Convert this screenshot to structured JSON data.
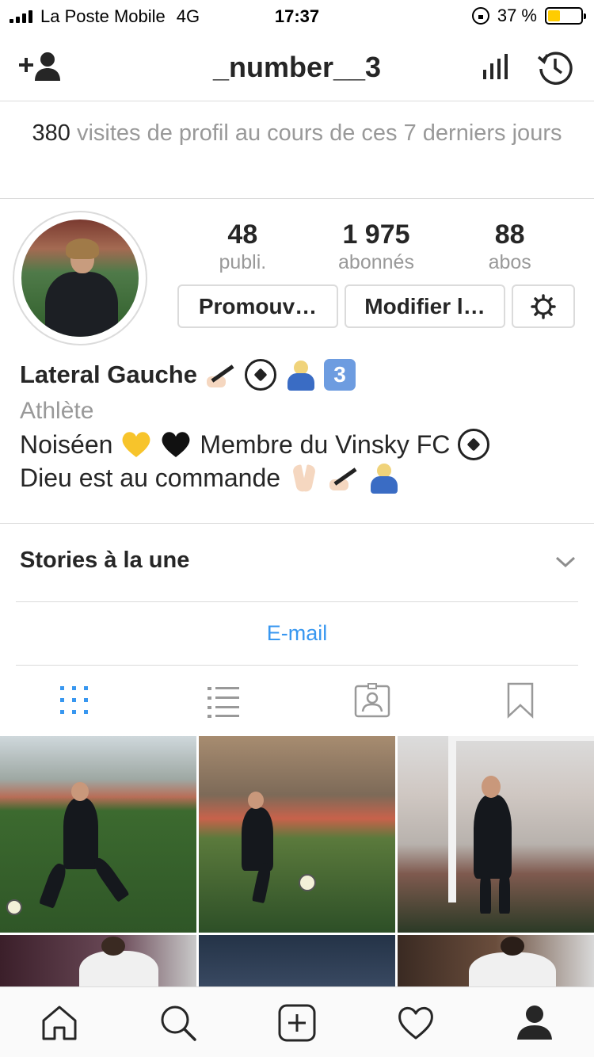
{
  "status_bar": {
    "carrier": "La Poste Mobile",
    "network": "4G",
    "time": "17:37",
    "battery": "37 %",
    "battery_level": 0.37,
    "battery_color": "#ffcc00"
  },
  "header": {
    "username": "_number__3",
    "icons": [
      "add-user-icon",
      "stats-icon",
      "history-icon"
    ]
  },
  "insights": {
    "count": "380",
    "text": " visites de profil au cours de ces 7 derniers jours"
  },
  "profile": {
    "stats": [
      {
        "value": "48",
        "label": "publi."
      },
      {
        "value": "1 975",
        "label": "abonnés"
      },
      {
        "value": "88",
        "label": "abos"
      }
    ],
    "buttons": {
      "promote": "Promouv…",
      "edit": "Modifier l…"
    }
  },
  "bio": {
    "name": "Lateral Gauche",
    "name_emoji": [
      "pen",
      "soccer-ball",
      "bowing",
      "keycap-3"
    ],
    "category": "Athlète",
    "line1_a": "Noiséen",
    "line1_b": "Membre du Vinsky FC",
    "line2": "Dieu est au commande"
  },
  "highlights": {
    "title": "Stories à la une"
  },
  "contact": {
    "email_label": "E-mail"
  },
  "tabs": [
    "grid-icon",
    "list-icon",
    "tagged-icon",
    "saved-icon"
  ],
  "bottom_nav": [
    "home-icon",
    "search-icon",
    "new-post-icon",
    "activity-icon",
    "profile-icon"
  ],
  "colors": {
    "accent": "#3897f0",
    "text": "#262626",
    "muted": "#999999",
    "border": "#dbdbdb"
  }
}
